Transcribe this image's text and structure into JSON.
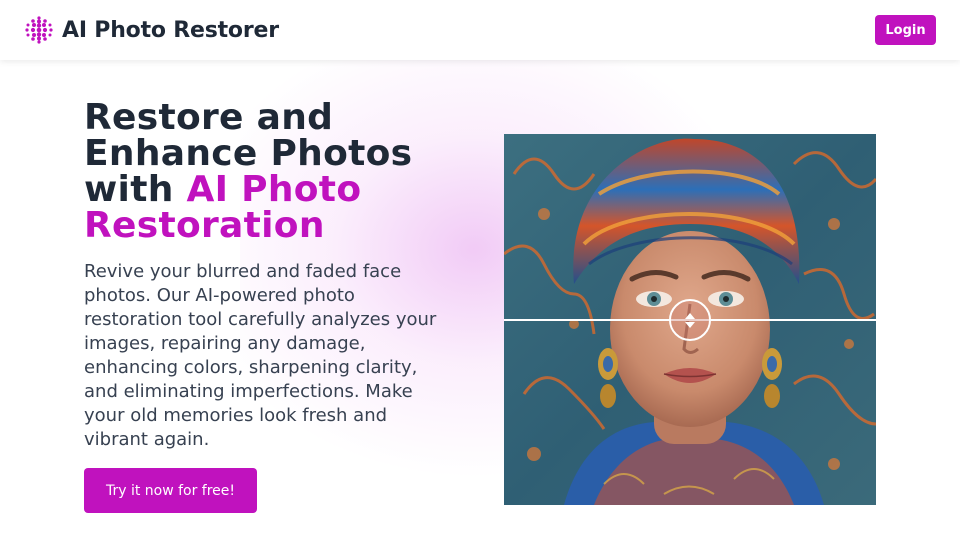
{
  "header": {
    "brand_name": "AI Photo Restorer",
    "logo_icon": "dot-grid-logo-icon",
    "login_label": "Login"
  },
  "hero": {
    "headline_line1": "Restore and",
    "headline_line2": "Enhance Photos",
    "headline_line3_plain": "with ",
    "headline_line3_accent": "AI Photo",
    "headline_line4_accent": "Restoration",
    "description": "Revive your blurred and faded face photos. Our AI-powered photo restoration tool carefully analyzes your images, repairing any damage, enhancing colors, sharpening clarity, and eliminating imperfections. Make your old memories look fresh and vibrant again.",
    "cta_label": "Try it now for free!"
  },
  "comparison": {
    "slider_icon": "up-down-arrows-icon",
    "slider_position": 0.5
  },
  "colors": {
    "accent": "#c012be",
    "text_dark": "#1f2937",
    "text_body": "#374151"
  }
}
